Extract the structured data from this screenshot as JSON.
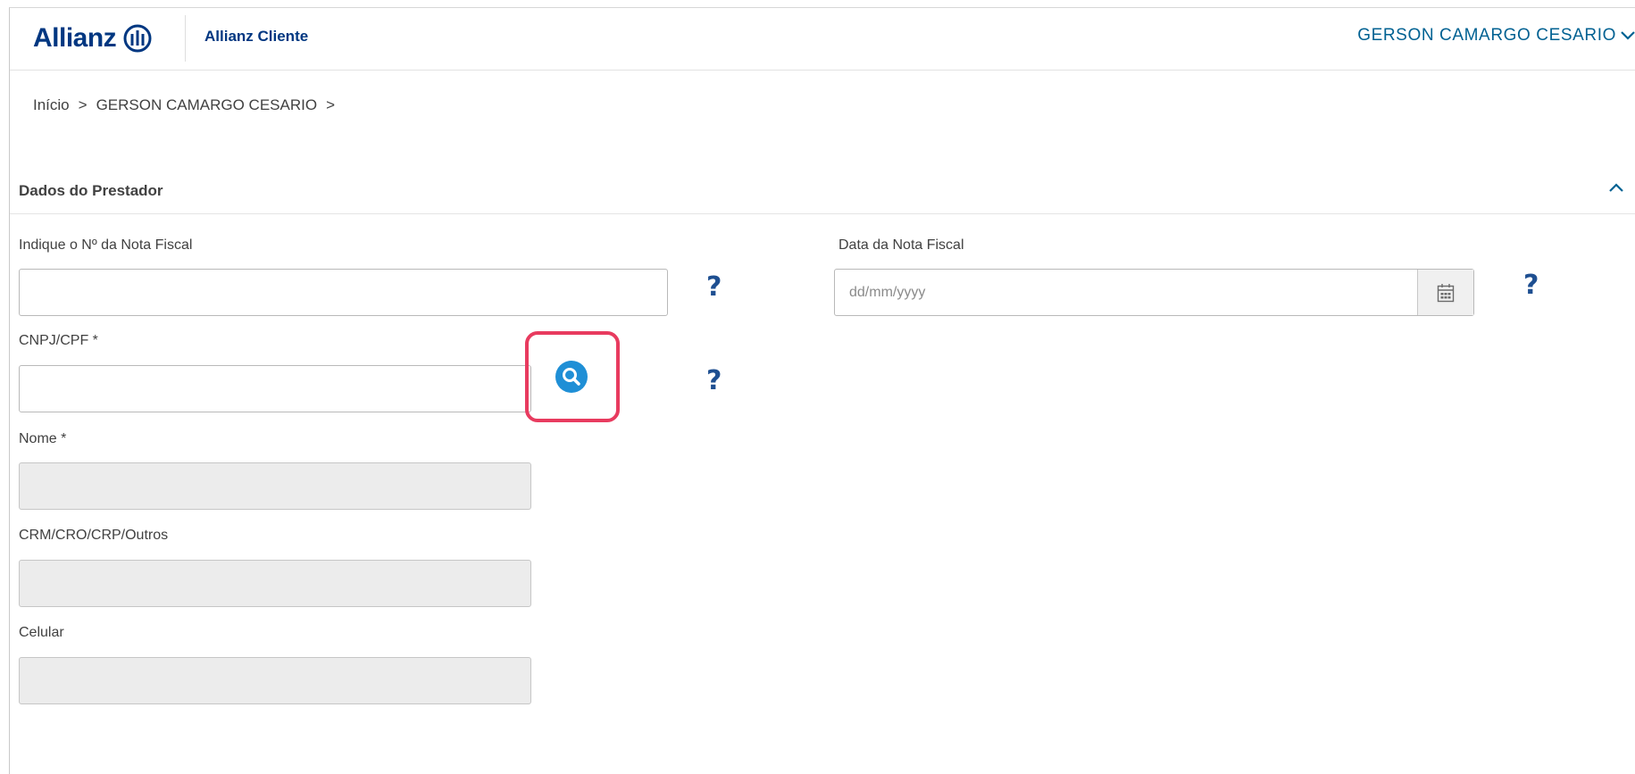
{
  "header": {
    "brand": "Allianz",
    "app_name": "Allianz Cliente",
    "user_name": "GERSON CAMARGO CESARIO"
  },
  "breadcrumb": {
    "home": "Início",
    "separator": ">",
    "current": "GERSON CAMARGO CESARIO"
  },
  "section": {
    "title": "Dados do Prestador",
    "collapse_icon": "chevron-up-icon"
  },
  "form": {
    "invoice_number": {
      "label": "Indique o Nº da Nota Fiscal",
      "value": "",
      "help": "?"
    },
    "invoice_date": {
      "label": "Data da Nota Fiscal",
      "placeholder": "dd/mm/yyyy",
      "value": "",
      "help": "?"
    },
    "cnpj_cpf": {
      "label": "CNPJ/CPF *",
      "value": "",
      "help": "?",
      "search_icon": "search-icon"
    },
    "name": {
      "label": "Nome *",
      "value": ""
    },
    "crm": {
      "label": "CRM/CRO/CRP/Outros",
      "value": ""
    },
    "phone": {
      "label": "Celular",
      "value": ""
    }
  },
  "colors": {
    "brand_blue": "#003781",
    "link_blue": "#006192",
    "search_blue": "#1f8fd6",
    "highlight": "#e83b5f"
  }
}
